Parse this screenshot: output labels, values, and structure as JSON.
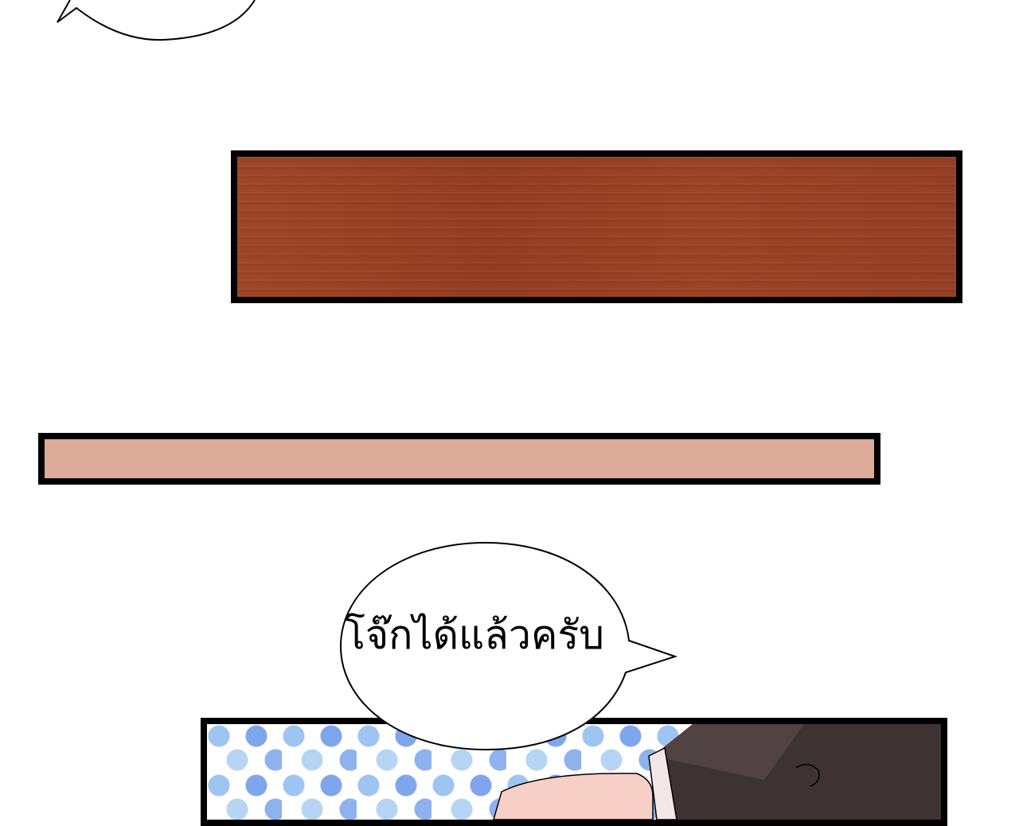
{
  "speech_bubble": {
    "text": "โจ๊กได้แล้วครับ"
  },
  "colors": {
    "wood": "#9b4125",
    "pink": "#dcab9a",
    "dot_blue": "#7fa6ec",
    "dot_light_blue": "#b6d5f5",
    "border": "#000000",
    "background": "#ffffff"
  }
}
